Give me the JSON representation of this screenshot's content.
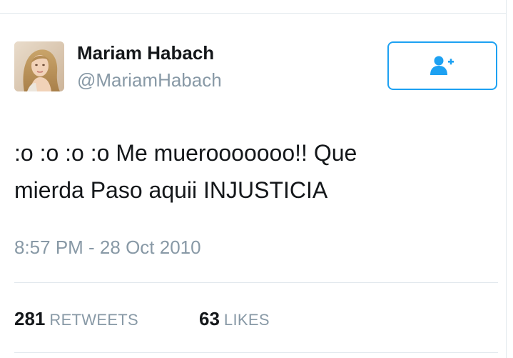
{
  "tweet": {
    "author": {
      "display_name": "Mariam Habach",
      "screen_name": "@MariamHabach",
      "avatar_icon": "profile-photo"
    },
    "follow_button": {
      "icon": "add-user-icon",
      "color": "#1da1f2"
    },
    "text_line_1": ":o :o :o :o Me muerooooooo!! Que",
    "text_line_2": "mierda Paso aquii INJUSTICIA",
    "timestamp": "8:57 PM - 28 Oct 2010",
    "stats": {
      "retweets_count": "281",
      "retweets_label": "RETWEETS",
      "likes_count": "63",
      "likes_label": "LIKES"
    }
  },
  "colors": {
    "text_primary": "#14171a",
    "text_secondary": "#8899a6",
    "accent": "#1da1f2",
    "border": "#e1e8ed"
  }
}
